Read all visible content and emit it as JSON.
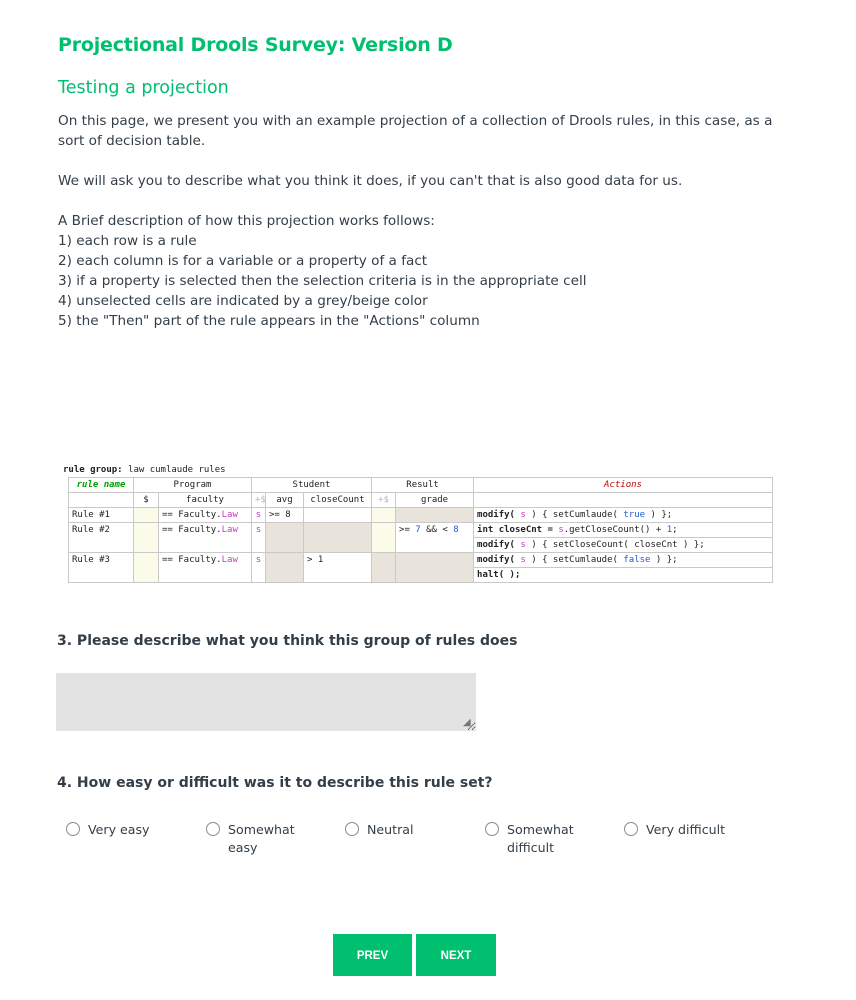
{
  "survey": {
    "title": "Projectional Drools Survey: Version D",
    "subtitle": "Testing a projection"
  },
  "intro": {
    "p1": "On this page, we present you with an example projection of a collection of Drools rules, in this case, as a sort of decision table.",
    "p2": "We will ask you to describe what you think it does, if you can't that is also good data for us.",
    "list_heading": "A Brief description of how this projection works follows:",
    "items": [
      "1) each row is a rule",
      "2) each column is for a variable or a property of a fact",
      "3) if a property is selected then the selection criteria is in the appropriate cell",
      "4) unselected cells are indicated by a grey/beige color",
      "5) the \"Then\" part of the rule appears in the \"Actions\" column"
    ]
  },
  "projection": {
    "group_label": "rule group:",
    "group_name": "law cumlaude rules",
    "headers": {
      "rule_name": "rule name",
      "program": "Program",
      "student": "Student",
      "result": "Result",
      "actions": "Actions"
    },
    "subheaders": {
      "dollar": "$",
      "faculty": "faculty",
      "plus_dollar": "+$",
      "avg": "avg",
      "close_count": "closeCount",
      "grade": "grade"
    },
    "rows": [
      {
        "name": "Rule #1",
        "faculty": "== Faculty.",
        "faculty_val": "Law",
        "s": "s",
        "avg": ">= 8",
        "close_count": "",
        "grade": "",
        "actions": [
          {
            "pre": "modify( ",
            "var": "s",
            "mid": " ) { setCumlaude( ",
            "val": "true",
            "post": " ) };"
          }
        ]
      },
      {
        "name": "Rule #2",
        "faculty": "== Faculty.",
        "faculty_val": "Law",
        "s": "s",
        "avg": "",
        "close_count": "",
        "grade_pre": ">= ",
        "grade_a": "7",
        "grade_mid": " && < ",
        "grade_b": "8",
        "actions": [
          {
            "pre": "int closeCnt = ",
            "var": "s",
            "mid": ".getCloseCount() + ",
            "val": "1",
            "post": ";"
          },
          {
            "pre": "modify( ",
            "var": "s",
            "mid": " ) { setCloseCount( closeCnt ) };",
            "val": "",
            "post": ""
          }
        ]
      },
      {
        "name": "Rule #3",
        "faculty": "== Faculty.",
        "faculty_val": "Law",
        "s": "s",
        "avg": "",
        "close_count": "> 1",
        "grade": "",
        "actions": [
          {
            "pre": "modify( ",
            "var": "s",
            "mid": " ) { setCumlaude( ",
            "val": "false",
            "post": " ) };"
          },
          {
            "pre": "halt( );",
            "var": "",
            "mid": "",
            "val": "",
            "post": ""
          }
        ]
      }
    ]
  },
  "q3": {
    "label": "3. Please describe what you think this group of rules does",
    "value": ""
  },
  "q4": {
    "label": "4. How easy or difficult was it to describe this rule set?",
    "options": [
      "Very easy",
      "Somewhat easy",
      "Neutral",
      "Somewhat difficult",
      "Very difficult"
    ]
  },
  "nav": {
    "prev": "PREV",
    "next": "NEXT"
  },
  "colors": {
    "brand_green": "#00bf6f",
    "unselected_cell": "#e8e4dc",
    "text": "#333e48"
  }
}
